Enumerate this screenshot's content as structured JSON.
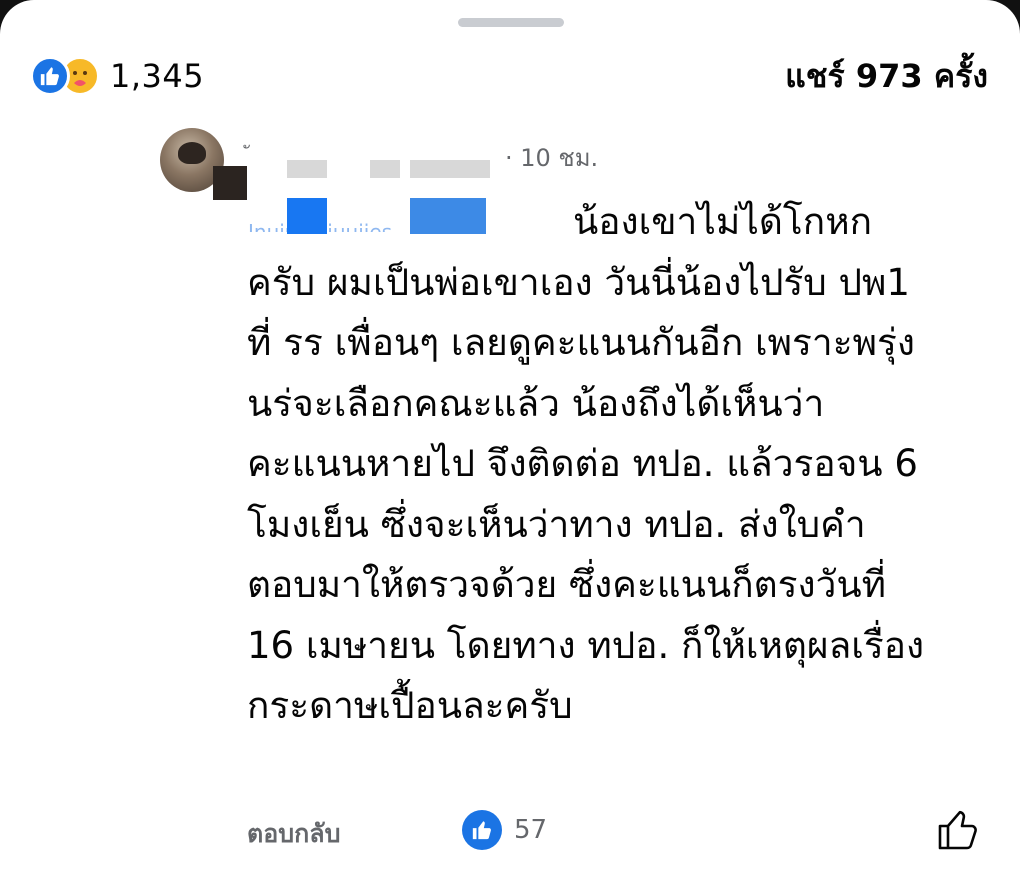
{
  "summary": {
    "reaction_count": "1,345",
    "shares_text": "แชร์ 973 ครั้ง",
    "reaction_icons": [
      "like-icon",
      "care-icon"
    ]
  },
  "comment": {
    "time_text": "· 10 ชม.",
    "mention_tail": "Inuiu Luiuuiies",
    "body": "น้องเขาไม่ได้โกหก\nครับ ผมเป็นพ่อเขาเอง วันนี่น้องไปรับ ปพ1\nที่ รร เพื่อนๆ เลยดูคะแนนกันอีก เพราะพรุ่ง\nนร่จะเลือกคณะแล้ว น้องถึงได้เห็นว่า\nคะแนนหายไป จึงติดต่อ ทปอ. แล้วรอจน 6\nโมงเย็น ซึ่งจะเห็นว่าทาง ทปอ. ส่งใบคำ\nตอบมาให้ตรวจด้วย ซึ่งคะแนนก็ตรงวันที่\n16 เมษายน โดยทาง ทปอ. ก็ให้เหตุผลเรื่อง\nกระดาษเปื้อนละครับ",
    "reply_label": "ตอบกลับ",
    "like_count": "57"
  },
  "colors": {
    "accent": "#1877f2",
    "secondary_text": "#65676b",
    "primary_text": "#050505"
  }
}
